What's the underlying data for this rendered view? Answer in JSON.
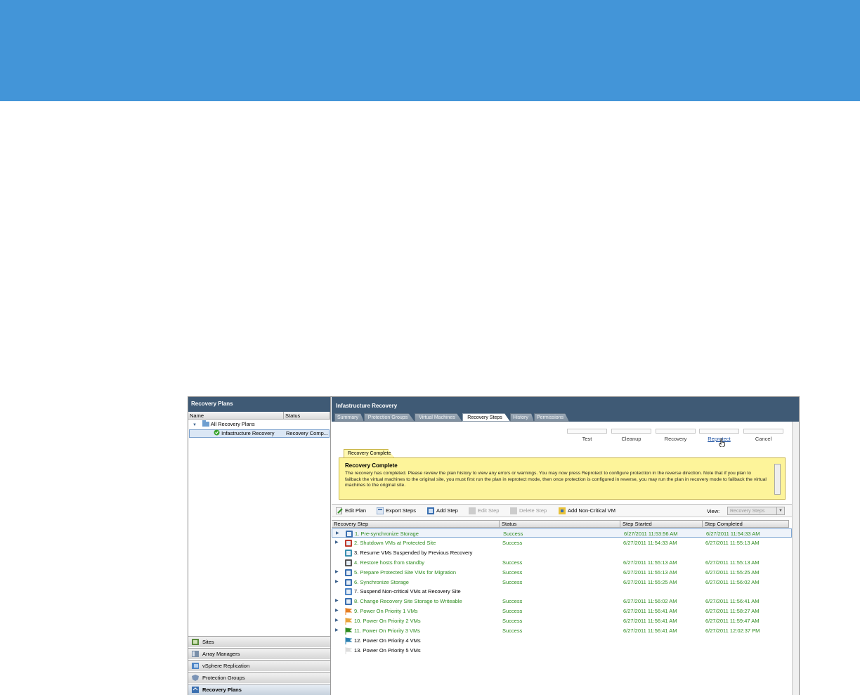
{
  "left": {
    "title": "Recovery Plans",
    "col_name": "Name",
    "col_status": "Status",
    "tree": {
      "root": "All Recovery Plans",
      "child_name": "Infastructure Recovery",
      "child_status": "Recovery Comp..."
    },
    "nav": [
      "Sites",
      "Array Managers",
      "vSphere Replication",
      "Protection Groups",
      "Recovery Plans"
    ]
  },
  "right": {
    "title": "Infastructure Recovery",
    "tabs": [
      "Summary",
      "Protection Groups",
      "Virtual Machines",
      "Recovery Steps",
      "History",
      "Permissions"
    ],
    "actions": [
      "Test",
      "Cleanup",
      "Recovery",
      "Reprotect",
      "Cancel"
    ],
    "banner_tab": "Recovery Complete",
    "banner_title": "Recovery Complete",
    "banner_msg": "The recovery has completed. Please review the plan history to view any errors or warnings. You may now press Reprotect to configure protection in the reverse direction. Note that if you plan to failback the virtual machines to the original site, you must first run the plan in reprotect mode, then once protection is configured in reverse, you may run the plan in recovery mode to failback the virtual machines to the original site.",
    "toolbar": [
      "Edit Plan",
      "Export Steps",
      "Add Step",
      "Edit Step",
      "Delete Step",
      "Add Non-Critical VM"
    ],
    "view_label": "View:",
    "view_value": "Recovery Steps",
    "columns": [
      "Recovery Step",
      "Status",
      "Step Started",
      "Step Completed"
    ],
    "rows": [
      {
        "step": "1. Pre-synchronize Storage",
        "status": "Success",
        "started": "6/27/2011 11:53:56 AM",
        "completed": "6/27/2011 11:54:33 AM"
      },
      {
        "step": "2. Shutdown VMs at Protected Site",
        "status": "Success",
        "started": "6/27/2011 11:54:33 AM",
        "completed": "6/27/2011 11:55:13 AM"
      },
      {
        "step": "3. Resume VMs Suspended by Previous Recovery",
        "status": "",
        "started": "",
        "completed": ""
      },
      {
        "step": "4. Restore hosts from standby",
        "status": "Success",
        "started": "6/27/2011 11:55:13 AM",
        "completed": "6/27/2011 11:55:13 AM"
      },
      {
        "step": "5. Prepare Protected Site VMs for Migration",
        "status": "Success",
        "started": "6/27/2011 11:55:13 AM",
        "completed": "6/27/2011 11:55:25 AM"
      },
      {
        "step": "6. Synchronize Storage",
        "status": "Success",
        "started": "6/27/2011 11:55:25 AM",
        "completed": "6/27/2011 11:56:02 AM"
      },
      {
        "step": "7. Suspend Non-critical VMs at Recovery Site",
        "status": "",
        "started": "",
        "completed": ""
      },
      {
        "step": "8. Change Recovery Site Storage to Writeable",
        "status": "Success",
        "started": "6/27/2011 11:56:02 AM",
        "completed": "6/27/2011 11:56:41 AM"
      },
      {
        "step": "9. Power On Priority 1 VMs",
        "status": "Success",
        "started": "6/27/2011 11:56:41 AM",
        "completed": "6/27/2011 11:58:27 AM"
      },
      {
        "step": "10. Power On Priority 2 VMs",
        "status": "Success",
        "started": "6/27/2011 11:56:41 AM",
        "completed": "6/27/2011 11:59:47 AM"
      },
      {
        "step": "11. Power On Priority 3 VMs",
        "status": "Success",
        "started": "6/27/2011 11:56:41 AM",
        "completed": "6/27/2011 12:02:37 PM"
      },
      {
        "step": "12. Power On Priority 4 VMs",
        "status": "",
        "started": "",
        "completed": ""
      },
      {
        "step": "13. Power On Priority 5 VMs",
        "status": "",
        "started": "",
        "completed": ""
      }
    ]
  },
  "colors": {
    "banner": "#4395d8",
    "header": "#3f5a75",
    "success": "#2e8b1f",
    "link": "#1a4fa0"
  }
}
